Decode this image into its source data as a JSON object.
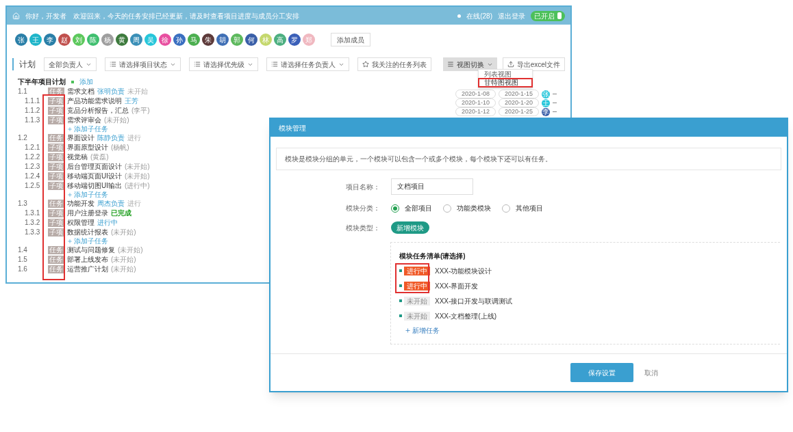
{
  "main_window": {
    "title": "你好，开发者　欢迎回来，今天的任务安排已经更新，请及时查看项目进度与成员分工安排",
    "status": "在线(28)",
    "logout": "退出登录",
    "toggle": {
      "label": "已开启",
      "on": true
    }
  },
  "members": [
    {
      "initial": "张",
      "color": "#2a7fa8"
    },
    {
      "initial": "王",
      "color": "#1fb5c9"
    },
    {
      "initial": "李",
      "color": "#2a7fa8"
    },
    {
      "initial": "赵",
      "color": "#c0504d"
    },
    {
      "initial": "刘",
      "color": "#5cc85c"
    },
    {
      "initial": "陈",
      "color": "#3fbf6f"
    },
    {
      "initial": "杨",
      "color": "#9e9e9e"
    },
    {
      "initial": "黄",
      "color": "#3d7a3d"
    },
    {
      "initial": "周",
      "color": "#3a8fb7"
    },
    {
      "initial": "吴",
      "color": "#26c6da"
    },
    {
      "initial": "徐",
      "color": "#e84fa0"
    },
    {
      "initial": "孙",
      "color": "#3a6fc0"
    },
    {
      "initial": "马",
      "color": "#4caf50"
    },
    {
      "initial": "朱",
      "color": "#5d3a3a"
    },
    {
      "initial": "胡",
      "color": "#3f6fb5"
    },
    {
      "initial": "郭",
      "color": "#5cb85c"
    },
    {
      "initial": "何",
      "color": "#3a5fa8"
    },
    {
      "initial": "林",
      "color": "#c5d86d"
    },
    {
      "initial": "高",
      "color": "#4caf80"
    },
    {
      "initial": "罗",
      "color": "#3a5fb8"
    },
    {
      "initial": "郑",
      "color": "#f0b8c0"
    }
  ],
  "add_member": "添加成员",
  "toolbar": {
    "label": "计划",
    "filters": [
      "全部负责人",
      "请选择项目状态",
      "请选择优先级",
      "请选择任务负责人"
    ],
    "favorite": "我关注的任务列表",
    "view_switch": "视图切换",
    "export": "导出excel文件"
  },
  "view_menu": {
    "items": [
      {
        "label": "列表视图",
        "selected": false
      },
      {
        "label": "甘特图视图",
        "selected": true
      }
    ]
  },
  "tree": {
    "title": "下半年项目计划",
    "add": "添加",
    "items": [
      {
        "number": "1.1",
        "tag": "任务",
        "title": "需求文档",
        "note": "张明负责",
        "kind": "link",
        "status": "未开始",
        "children": [
          {
            "number": "1.1.1",
            "tag": "子项",
            "title": "产品功能需求说明",
            "note": "王芳",
            "kind": "link"
          },
          {
            "number": "1.1.2",
            "tag": "子项",
            "title": "竞品分析报告，汇总",
            "note": "(李平)",
            "kind": "muted"
          },
          {
            "number": "1.1.3",
            "tag": "子项",
            "title": "需求评审会",
            "note": "(未开始)",
            "kind": "muted"
          }
        ],
        "add_child": "添加子任务"
      },
      {
        "number": "1.2",
        "tag": "任务",
        "title": "界面设计",
        "note": "陈静负责",
        "kind": "link",
        "status": "进行",
        "children": [
          {
            "number": "1.2.1",
            "tag": "子项",
            "title": "界面原型设计",
            "note": "(杨帆)",
            "kind": "muted"
          },
          {
            "number": "1.2.2",
            "tag": "子项",
            "title": "视觉稿",
            "note": "(黄磊)",
            "kind": "muted"
          },
          {
            "number": "1.2.3",
            "tag": "子项",
            "title": "后台管理页面设计",
            "note": "(未开始)",
            "kind": "muted"
          },
          {
            "number": "1.2.4",
            "tag": "子项",
            "title": "移动端页面UI设计",
            "note": "(未开始)",
            "kind": "muted"
          },
          {
            "number": "1.2.5",
            "tag": "子项",
            "title": "移动端切图UI输出",
            "note": "(进行中)",
            "kind": "muted"
          }
        ],
        "add_child": "添加子任务"
      },
      {
        "number": "1.3",
        "tag": "任务",
        "title": "功能开发",
        "note": "周杰负责",
        "kind": "link",
        "status": "进行",
        "children": [
          {
            "number": "1.3.1",
            "tag": "子项",
            "title": "用户注册登录",
            "note": "已完成",
            "kind": "done"
          },
          {
            "number": "1.3.2",
            "tag": "子项",
            "title": "权限管理",
            "note": "进行中",
            "kind": "link"
          },
          {
            "number": "1.3.3",
            "tag": "子项",
            "title": "数据统计报表",
            "note": "(未开始)",
            "kind": "muted"
          }
        ],
        "add_child": "添加子任务"
      },
      {
        "number": "1.4",
        "tag": "任务",
        "title": "测试与问题修复",
        "note": "(未开始)",
        "kind": "muted"
      },
      {
        "number": "1.5",
        "tag": "任务",
        "title": "部署上线发布",
        "note": "(未开始)",
        "kind": "muted"
      },
      {
        "number": "1.6",
        "tag": "任务",
        "title": "运营推广计划",
        "note": "(未开始)",
        "kind": "muted"
      }
    ]
  },
  "schedule": [
    {
      "start": "2020-1-08",
      "end": "2020-1-15",
      "initial": "张",
      "color": "#26c6da"
    },
    {
      "start": "2020-1-10",
      "end": "2020-1-20",
      "initial": "王",
      "color": "#26c6da"
    },
    {
      "start": "2020-1-12",
      "end": "2020-1-25",
      "initial": "李",
      "color": "#3a5fa8"
    }
  ],
  "dialog": {
    "title": "模块管理",
    "info": "模块是模块分组的单元，一个模块可以包含一个或多个模块，每个模块下还可以有任务。",
    "name_label": "项目名称：",
    "name_value": "文档项目",
    "category_label": "模块分类：",
    "categories": [
      {
        "label": "全部项目",
        "selected": true
      },
      {
        "label": "功能类模块",
        "selected": false
      },
      {
        "label": "其他项目",
        "selected": false
      }
    ],
    "type_label": "模块类型：",
    "type_value": "新增模块",
    "group_title": "模块任务清单(请选择)",
    "tasks": [
      {
        "tag": "进行中",
        "kind": "active",
        "title": "XXX-功能模块设计"
      },
      {
        "tag": "进行中",
        "kind": "active",
        "title": "XXX-界面开发"
      },
      {
        "tag": "未开始",
        "kind": "pending",
        "title": "XXX-接口开发与联调测试"
      },
      {
        "tag": "未开始",
        "kind": "pending",
        "title": "XXX-文档整理(上线)"
      }
    ],
    "add_task": "新增任务",
    "save": "保存设置",
    "cancel": "取消"
  }
}
